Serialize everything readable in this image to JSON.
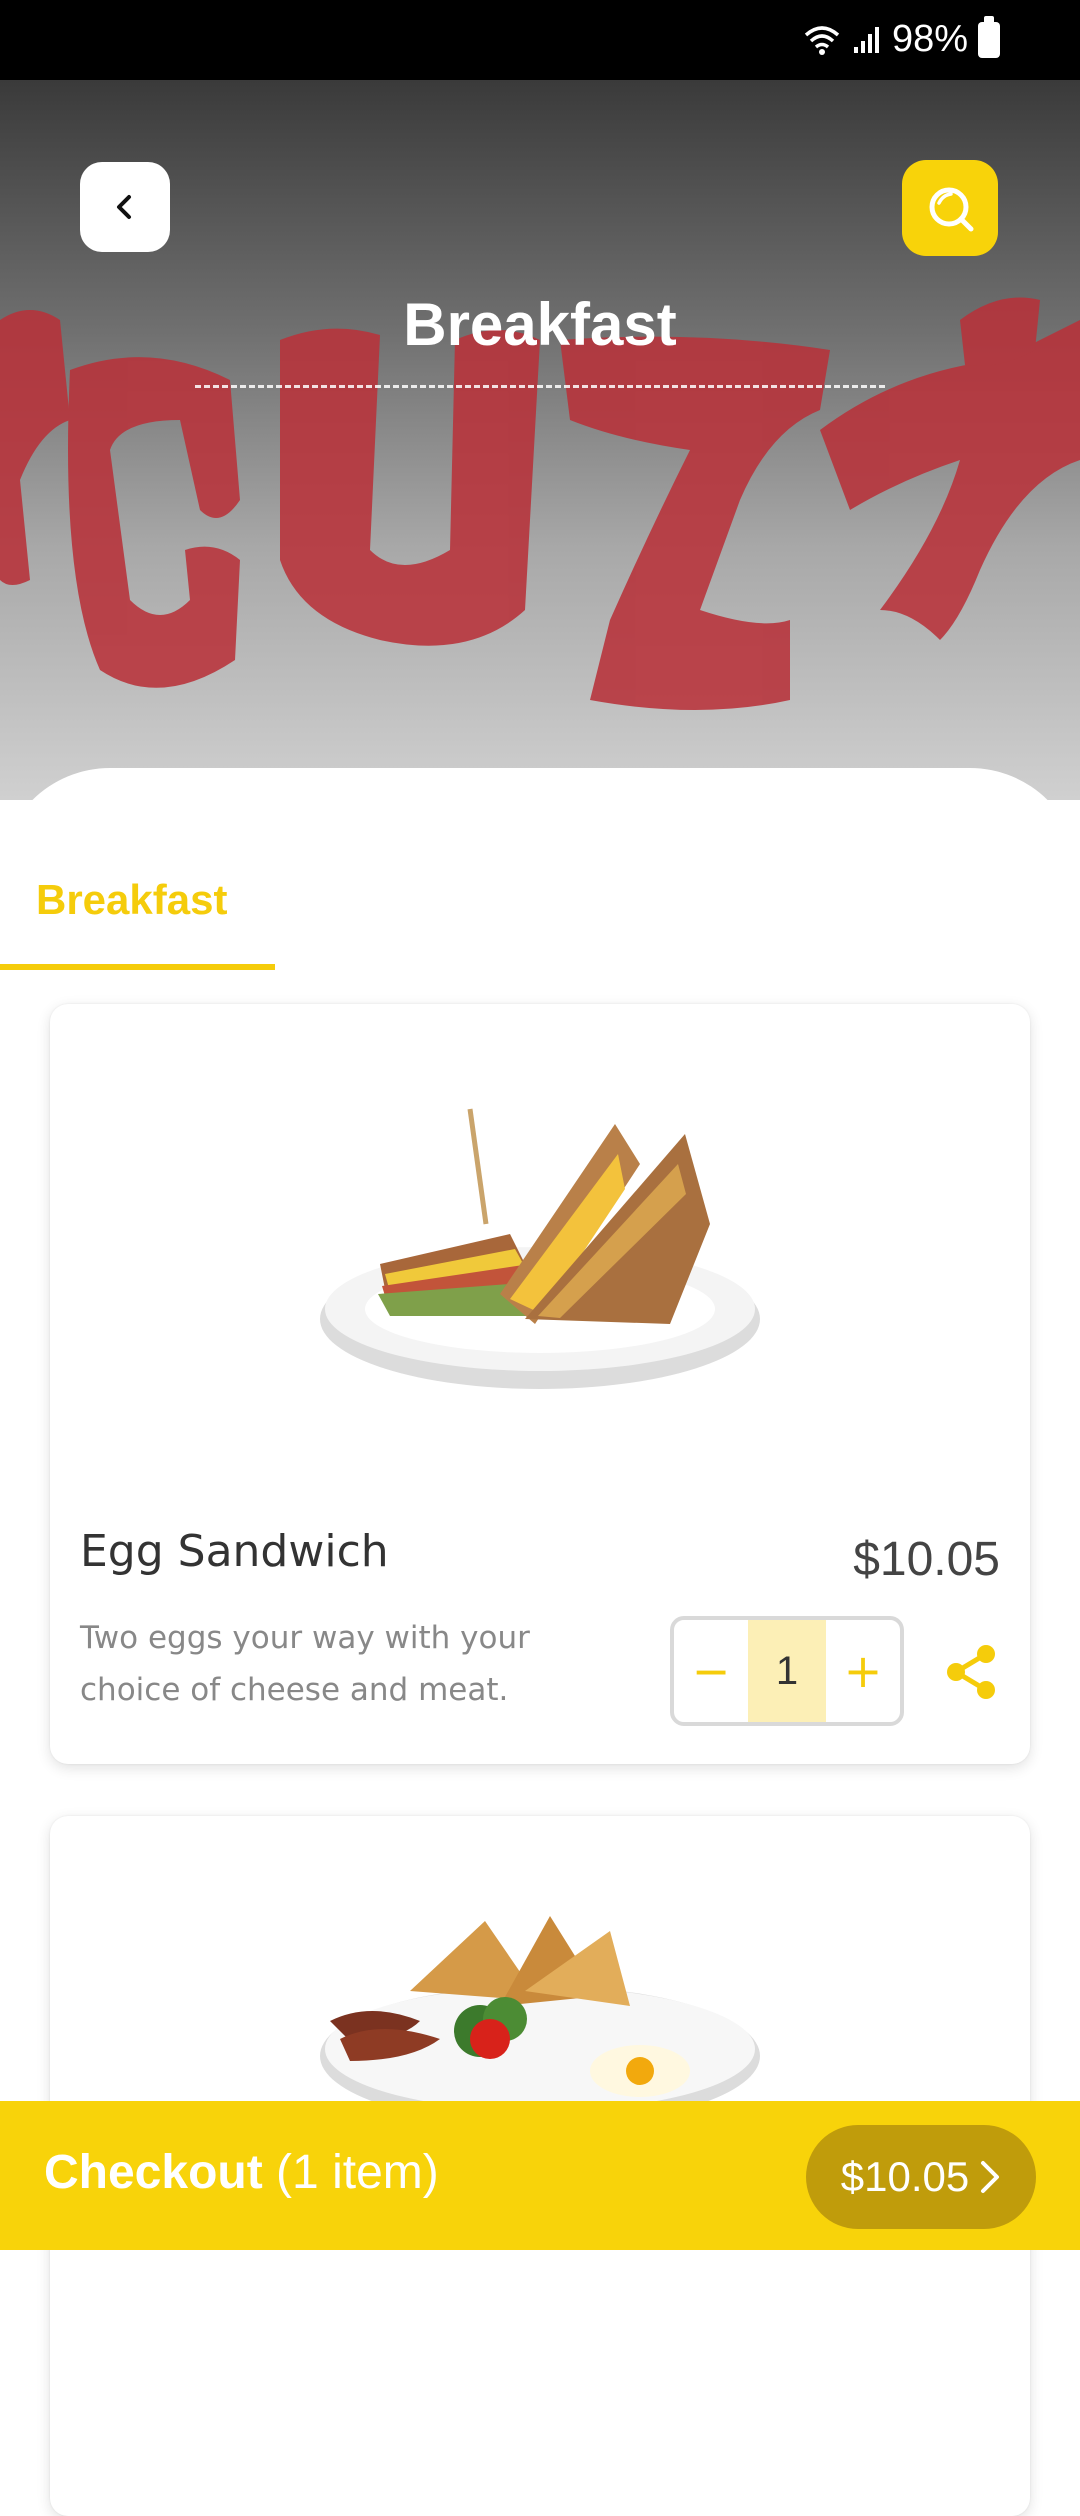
{
  "status_bar": {
    "battery": "98%"
  },
  "header": {
    "title": "Breakfast"
  },
  "tabs": [
    {
      "label": "Breakfast",
      "active": true
    }
  ],
  "menu_items": [
    {
      "name": "Egg Sandwich",
      "price": "$10.05",
      "description_line1": "Two eggs your way with your",
      "description_line2": "choice of cheese and meat.",
      "quantity": "1",
      "minus": "−",
      "plus": "+"
    }
  ],
  "checkout": {
    "label": "Checkout",
    "count": "(1 item)",
    "total": "$10.05"
  },
  "colors": {
    "accent": "#f8d30a",
    "accent_dark": "#c09c0b",
    "logo_red": "#b8323a"
  },
  "icons": [
    "wifi-icon",
    "signal-icon",
    "battery-icon",
    "back-icon",
    "search-icon",
    "share-icon",
    "chevron-right-icon"
  ]
}
